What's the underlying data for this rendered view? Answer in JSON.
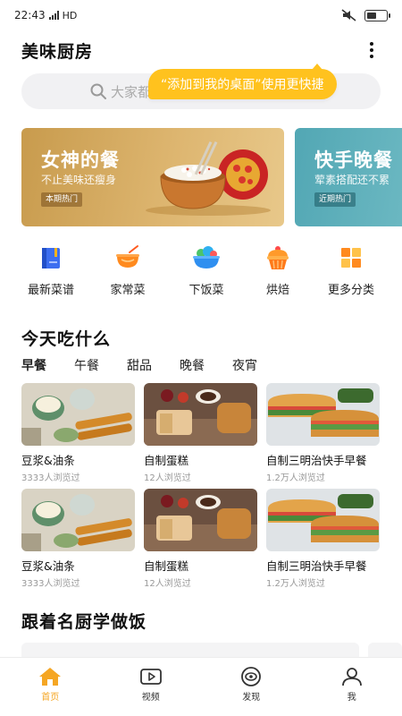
{
  "status_bar": {
    "time": "22:43",
    "network": "HD"
  },
  "header": {
    "title": "美味厨房"
  },
  "search": {
    "placeholder": "大家都在搜"
  },
  "tooltip": {
    "text": "“添加到我的桌面”使用更快捷"
  },
  "banners": [
    {
      "title": "女神的餐",
      "subtitle": "不止美味还瘦身",
      "tag": "本期热门"
    },
    {
      "title": "快手晚餐",
      "subtitle": "荤素搭配还不累",
      "tag": "近期热门"
    }
  ],
  "categories": [
    {
      "label": "最新菜谱",
      "icon": "book-icon",
      "color": "#3d6ef0"
    },
    {
      "label": "家常菜",
      "icon": "bowl-icon",
      "color": "#ff8a1e"
    },
    {
      "label": "下饭菜",
      "icon": "salad-icon",
      "color": "#2fb0f0"
    },
    {
      "label": "烘焙",
      "icon": "cupcake-icon",
      "color": "#ff9a2a"
    },
    {
      "label": "更多分类",
      "icon": "grid-icon",
      "color": "#ff8a1e"
    }
  ],
  "today": {
    "title": "今天吃什么",
    "tabs": [
      "早餐",
      "午餐",
      "甜品",
      "晚餐",
      "夜宵"
    ],
    "active_tab": "早餐",
    "recipes": [
      {
        "name": "豆浆&油条",
        "views": "3333人浏览过"
      },
      {
        "name": "自制蛋糕",
        "views": "12人浏览过"
      },
      {
        "name": "自制三明治快手早餐",
        "views": "1.2万人浏览过"
      },
      {
        "name": "豆浆&油条",
        "views": "3333人浏览过"
      },
      {
        "name": "自制蛋糕",
        "views": "12人浏览过"
      },
      {
        "name": "自制三明治快手早餐",
        "views": "1.2万人浏览过"
      }
    ]
  },
  "chef_section": {
    "title": "跟着名厨学做饭"
  },
  "bottom_nav": [
    {
      "label": "首页",
      "icon": "home-icon",
      "active": true
    },
    {
      "label": "视频",
      "icon": "video-icon",
      "active": false
    },
    {
      "label": "发现",
      "icon": "discover-icon",
      "active": false
    },
    {
      "label": "我",
      "icon": "profile-icon",
      "active": false
    }
  ],
  "colors": {
    "accent": "#f5a623",
    "tooltip": "#ffc21e",
    "tab_highlight": "#ffcb2f"
  }
}
